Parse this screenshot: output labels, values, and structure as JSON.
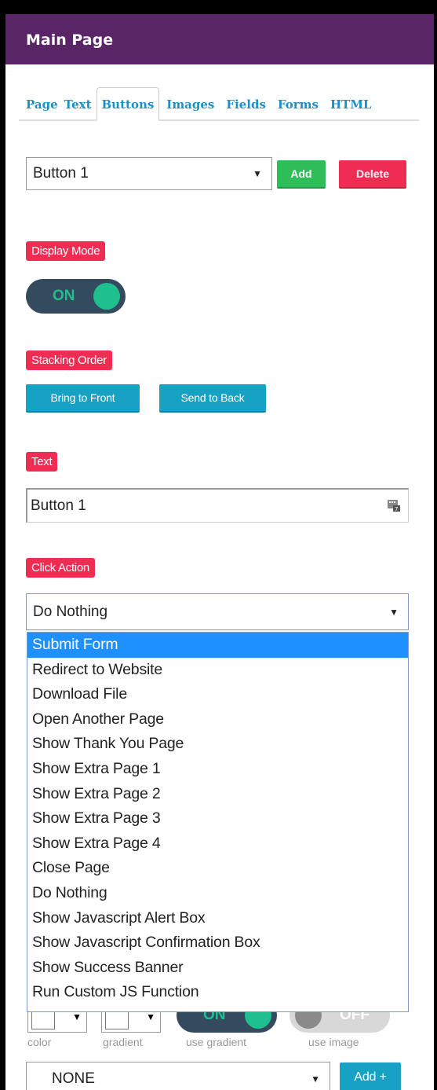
{
  "header": {
    "title": "Main Page"
  },
  "tabs": [
    {
      "label": "Page"
    },
    {
      "label": "Text"
    },
    {
      "label": "Buttons"
    },
    {
      "label": "Images"
    },
    {
      "label": "Fields"
    },
    {
      "label": "Forms"
    },
    {
      "label": "HTML"
    }
  ],
  "button_select": {
    "value": "Button 1"
  },
  "actions": {
    "add": "Add",
    "delete": "Delete"
  },
  "display_mode": {
    "label": "Display Mode",
    "toggle": "ON"
  },
  "stacking": {
    "label": "Stacking Order",
    "front": "Bring to Front",
    "back": "Send to Back"
  },
  "text_field": {
    "label": "Text",
    "value": "Button 1"
  },
  "click_action": {
    "label": "Click Action",
    "value": "Do Nothing",
    "options": [
      "Submit Form",
      "Redirect to Website",
      "Download File",
      "Open Another Page",
      "Show Thank You Page",
      "Show Extra Page 1",
      "Show Extra Page 2",
      "Show Extra Page 3",
      "Show Extra Page 4",
      "Close Page",
      "Do Nothing",
      "Show Javascript Alert Box",
      "Show Javascript Confirmation Box",
      "Show Success Banner",
      "Run Custom JS Function"
    ],
    "highlighted_option": "Submit Form"
  },
  "style_row": {
    "use_gradient_toggle": "ON",
    "use_image_toggle": "OFF",
    "captions": {
      "color": "color",
      "gradient": "gradient",
      "use_gradient": "use gradient",
      "use_image": "use image"
    }
  },
  "bottom_select": {
    "value": "NONE",
    "add": "Add +"
  },
  "colors": {
    "header_bg": "#5a2566",
    "tab_link": "#1a8fc8",
    "green": "#2ebd59",
    "red": "#ef2d53",
    "teal": "#17a2c3",
    "toggle_dark": "#344a5e",
    "toggle_knob": "#1fbf8f",
    "selected_option": "#1e90ff"
  }
}
